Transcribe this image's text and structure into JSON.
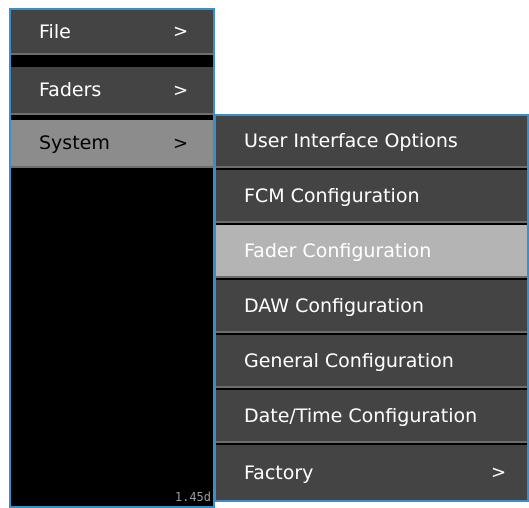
{
  "main_menu": {
    "items": [
      {
        "label": "File",
        "arrow": ">"
      },
      {
        "label": "Faders",
        "arrow": ">"
      },
      {
        "label": "System",
        "arrow": ">"
      }
    ],
    "version": "1.45d"
  },
  "system_submenu": {
    "items": [
      {
        "label": "User Interface Options"
      },
      {
        "label": "FCM Configuration"
      },
      {
        "label": "Fader Configuration"
      },
      {
        "label": "DAW Configuration"
      },
      {
        "label": "General Configuration"
      },
      {
        "label": "Date/Time Configuration"
      },
      {
        "label": "Factory",
        "arrow": ">"
      }
    ]
  },
  "colors": {
    "border": "#3a8fc8",
    "item_bg": "#444444",
    "selected_bg": "#8c8c8c",
    "highlight_bg": "#b4b4b4",
    "panel_bg": "#000000"
  }
}
